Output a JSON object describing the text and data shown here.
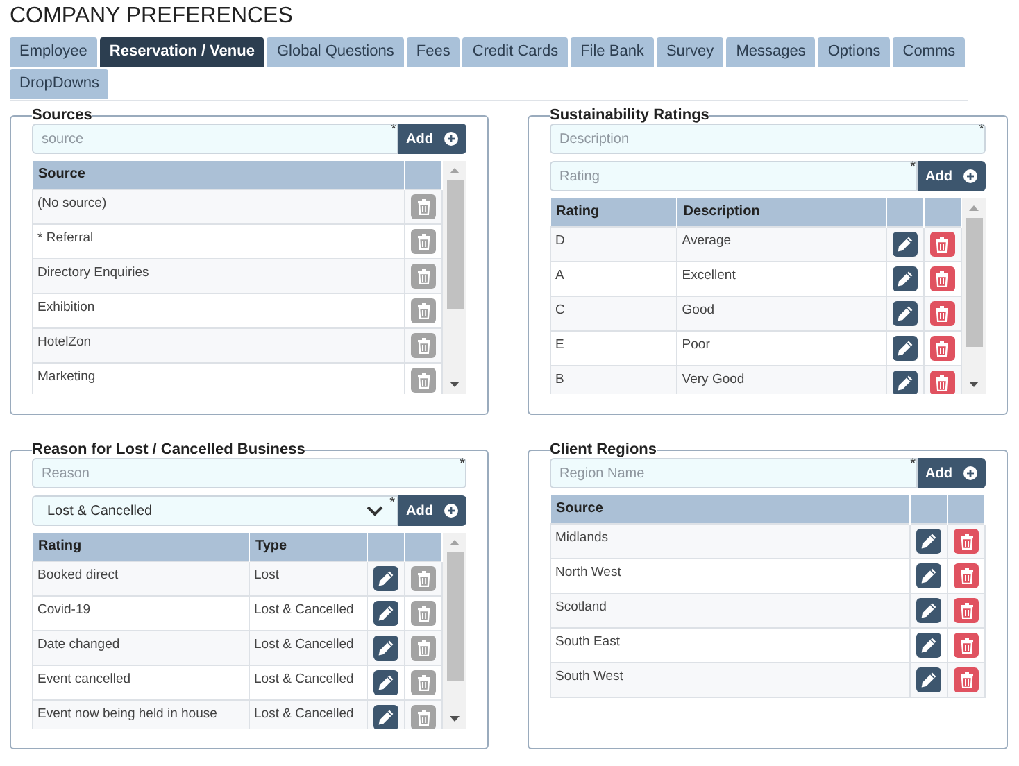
{
  "page_title": "COMPANY PREFERENCES",
  "tabs": [
    {
      "label": "Employee",
      "selected": false
    },
    {
      "label": "Reservation / Venue",
      "selected": true
    },
    {
      "label": "Global Questions",
      "selected": false
    },
    {
      "label": "Fees",
      "selected": false
    },
    {
      "label": "Credit Cards",
      "selected": false
    },
    {
      "label": "File Bank",
      "selected": false
    },
    {
      "label": "Survey",
      "selected": false
    },
    {
      "label": "Messages",
      "selected": false
    },
    {
      "label": "Options",
      "selected": false
    },
    {
      "label": "Comms",
      "selected": false
    },
    {
      "label": "DropDowns",
      "selected": false
    }
  ],
  "panels": [
    {
      "title": "Sources",
      "fields": [
        {
          "kind": "input",
          "placeholder": "source",
          "marker": "*",
          "add": "Add"
        }
      ],
      "table": {
        "columns": [
          "Source"
        ],
        "editable": false,
        "scrollbar": true,
        "rows": [
          {
            "cells": [
              "(No source)"
            ],
            "deletable": false
          },
          {
            "cells": [
              "* Referral"
            ],
            "deletable": false
          },
          {
            "cells": [
              "Directory Enquiries"
            ],
            "deletable": false
          },
          {
            "cells": [
              "Exhibition"
            ],
            "deletable": false
          },
          {
            "cells": [
              "HotelZon"
            ],
            "deletable": false
          },
          {
            "cells": [
              "Marketing"
            ],
            "deletable": false
          }
        ]
      }
    },
    {
      "title": "Sustainability Ratings",
      "fields": [
        {
          "kind": "input",
          "placeholder": "Description",
          "marker": "*"
        },
        {
          "kind": "input",
          "placeholder": "Rating",
          "marker": "*",
          "add": "Add"
        }
      ],
      "table": {
        "columns": [
          "Rating",
          "Description"
        ],
        "editable": true,
        "scrollbar": true,
        "rows": [
          {
            "cells": [
              "D",
              "Average"
            ],
            "deletable": true
          },
          {
            "cells": [
              "A",
              "Excellent"
            ],
            "deletable": true
          },
          {
            "cells": [
              "C",
              "Good"
            ],
            "deletable": true
          },
          {
            "cells": [
              "E",
              "Poor"
            ],
            "deletable": true
          },
          {
            "cells": [
              "B",
              "Very Good"
            ],
            "deletable": true
          }
        ]
      }
    },
    {
      "title": "Reason for Lost / Cancelled Business",
      "fields": [
        {
          "kind": "input",
          "placeholder": "Reason",
          "marker": "*"
        },
        {
          "kind": "select",
          "value": "Lost & Cancelled",
          "marker": "*",
          "add": "Add"
        }
      ],
      "table": {
        "columns": [
          "Rating",
          "Type"
        ],
        "editable": true,
        "scrollbar": true,
        "rows": [
          {
            "cells": [
              "Booked direct",
              "Lost"
            ],
            "deletable": false
          },
          {
            "cells": [
              "Covid-19",
              "Lost & Cancelled"
            ],
            "deletable": false
          },
          {
            "cells": [
              "Date changed",
              "Lost & Cancelled"
            ],
            "deletable": false
          },
          {
            "cells": [
              "Event cancelled",
              "Lost & Cancelled"
            ],
            "deletable": false
          },
          {
            "cells": [
              "Event now being held in house",
              "Lost & Cancelled"
            ],
            "deletable": false
          }
        ]
      }
    },
    {
      "title": "Client Regions",
      "fields": [
        {
          "kind": "input",
          "placeholder": "Region Name",
          "marker": "*",
          "add": "Add"
        }
      ],
      "table": {
        "columns": [
          "Source"
        ],
        "editable": true,
        "scrollbar": false,
        "rows": [
          {
            "cells": [
              "Midlands"
            ],
            "deletable": true
          },
          {
            "cells": [
              "North West"
            ],
            "deletable": true
          },
          {
            "cells": [
              "Scotland"
            ],
            "deletable": true
          },
          {
            "cells": [
              "South East"
            ],
            "deletable": true
          },
          {
            "cells": [
              "South West"
            ],
            "deletable": true
          }
        ]
      }
    }
  ]
}
